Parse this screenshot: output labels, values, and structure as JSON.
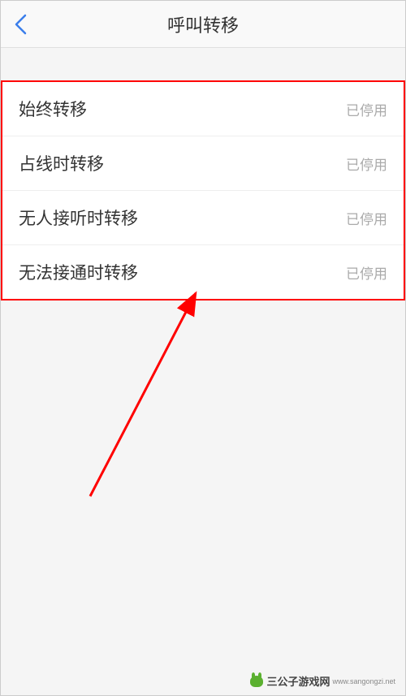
{
  "header": {
    "title": "呼叫转移"
  },
  "settings": [
    {
      "label": "始终转移",
      "status": "已停用"
    },
    {
      "label": "占线时转移",
      "status": "已停用"
    },
    {
      "label": "无人接听时转移",
      "status": "已停用"
    },
    {
      "label": "无法接通时转移",
      "status": "已停用"
    }
  ],
  "watermark": {
    "main": "三公子游戏网",
    "sub": "www.sangongzi.net"
  }
}
